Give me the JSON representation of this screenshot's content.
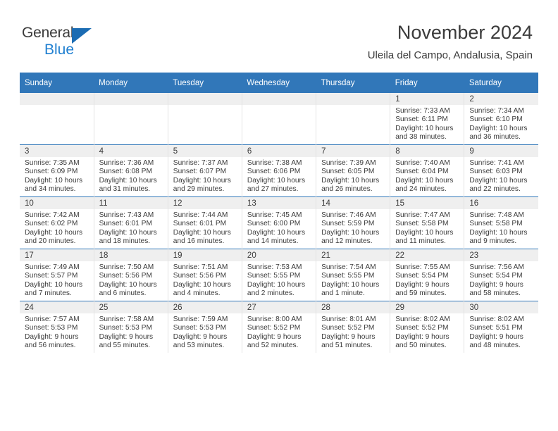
{
  "brand": {
    "name_part1": "General",
    "name_part2": "Blue",
    "triangle_color": "#1b6cb3",
    "blue_color": "#1f7fd0"
  },
  "header": {
    "title": "November 2024",
    "location": "Uleila del Campo, Andalusia, Spain"
  },
  "theme": {
    "header_blue": "#3177b9",
    "row_line_blue": "#3177b9",
    "daynum_band": "#efefef",
    "text": "#3b3b3b"
  },
  "weekday_headers": [
    "Sunday",
    "Monday",
    "Tuesday",
    "Wednesday",
    "Thursday",
    "Friday",
    "Saturday"
  ],
  "weeks": [
    [
      {
        "day": "",
        "sunrise": "",
        "sunset": "",
        "daylight_line1": "",
        "daylight_line2": ""
      },
      {
        "day": "",
        "sunrise": "",
        "sunset": "",
        "daylight_line1": "",
        "daylight_line2": ""
      },
      {
        "day": "",
        "sunrise": "",
        "sunset": "",
        "daylight_line1": "",
        "daylight_line2": ""
      },
      {
        "day": "",
        "sunrise": "",
        "sunset": "",
        "daylight_line1": "",
        "daylight_line2": ""
      },
      {
        "day": "",
        "sunrise": "",
        "sunset": "",
        "daylight_line1": "",
        "daylight_line2": ""
      },
      {
        "day": "1",
        "sunrise": "Sunrise: 7:33 AM",
        "sunset": "Sunset: 6:11 PM",
        "daylight_line1": "Daylight: 10 hours",
        "daylight_line2": "and 38 minutes."
      },
      {
        "day": "2",
        "sunrise": "Sunrise: 7:34 AM",
        "sunset": "Sunset: 6:10 PM",
        "daylight_line1": "Daylight: 10 hours",
        "daylight_line2": "and 36 minutes."
      }
    ],
    [
      {
        "day": "3",
        "sunrise": "Sunrise: 7:35 AM",
        "sunset": "Sunset: 6:09 PM",
        "daylight_line1": "Daylight: 10 hours",
        "daylight_line2": "and 34 minutes."
      },
      {
        "day": "4",
        "sunrise": "Sunrise: 7:36 AM",
        "sunset": "Sunset: 6:08 PM",
        "daylight_line1": "Daylight: 10 hours",
        "daylight_line2": "and 31 minutes."
      },
      {
        "day": "5",
        "sunrise": "Sunrise: 7:37 AM",
        "sunset": "Sunset: 6:07 PM",
        "daylight_line1": "Daylight: 10 hours",
        "daylight_line2": "and 29 minutes."
      },
      {
        "day": "6",
        "sunrise": "Sunrise: 7:38 AM",
        "sunset": "Sunset: 6:06 PM",
        "daylight_line1": "Daylight: 10 hours",
        "daylight_line2": "and 27 minutes."
      },
      {
        "day": "7",
        "sunrise": "Sunrise: 7:39 AM",
        "sunset": "Sunset: 6:05 PM",
        "daylight_line1": "Daylight: 10 hours",
        "daylight_line2": "and 26 minutes."
      },
      {
        "day": "8",
        "sunrise": "Sunrise: 7:40 AM",
        "sunset": "Sunset: 6:04 PM",
        "daylight_line1": "Daylight: 10 hours",
        "daylight_line2": "and 24 minutes."
      },
      {
        "day": "9",
        "sunrise": "Sunrise: 7:41 AM",
        "sunset": "Sunset: 6:03 PM",
        "daylight_line1": "Daylight: 10 hours",
        "daylight_line2": "and 22 minutes."
      }
    ],
    [
      {
        "day": "10",
        "sunrise": "Sunrise: 7:42 AM",
        "sunset": "Sunset: 6:02 PM",
        "daylight_line1": "Daylight: 10 hours",
        "daylight_line2": "and 20 minutes."
      },
      {
        "day": "11",
        "sunrise": "Sunrise: 7:43 AM",
        "sunset": "Sunset: 6:01 PM",
        "daylight_line1": "Daylight: 10 hours",
        "daylight_line2": "and 18 minutes."
      },
      {
        "day": "12",
        "sunrise": "Sunrise: 7:44 AM",
        "sunset": "Sunset: 6:01 PM",
        "daylight_line1": "Daylight: 10 hours",
        "daylight_line2": "and 16 minutes."
      },
      {
        "day": "13",
        "sunrise": "Sunrise: 7:45 AM",
        "sunset": "Sunset: 6:00 PM",
        "daylight_line1": "Daylight: 10 hours",
        "daylight_line2": "and 14 minutes."
      },
      {
        "day": "14",
        "sunrise": "Sunrise: 7:46 AM",
        "sunset": "Sunset: 5:59 PM",
        "daylight_line1": "Daylight: 10 hours",
        "daylight_line2": "and 12 minutes."
      },
      {
        "day": "15",
        "sunrise": "Sunrise: 7:47 AM",
        "sunset": "Sunset: 5:58 PM",
        "daylight_line1": "Daylight: 10 hours",
        "daylight_line2": "and 11 minutes."
      },
      {
        "day": "16",
        "sunrise": "Sunrise: 7:48 AM",
        "sunset": "Sunset: 5:58 PM",
        "daylight_line1": "Daylight: 10 hours",
        "daylight_line2": "and 9 minutes."
      }
    ],
    [
      {
        "day": "17",
        "sunrise": "Sunrise: 7:49 AM",
        "sunset": "Sunset: 5:57 PM",
        "daylight_line1": "Daylight: 10 hours",
        "daylight_line2": "and 7 minutes."
      },
      {
        "day": "18",
        "sunrise": "Sunrise: 7:50 AM",
        "sunset": "Sunset: 5:56 PM",
        "daylight_line1": "Daylight: 10 hours",
        "daylight_line2": "and 6 minutes."
      },
      {
        "day": "19",
        "sunrise": "Sunrise: 7:51 AM",
        "sunset": "Sunset: 5:56 PM",
        "daylight_line1": "Daylight: 10 hours",
        "daylight_line2": "and 4 minutes."
      },
      {
        "day": "20",
        "sunrise": "Sunrise: 7:53 AM",
        "sunset": "Sunset: 5:55 PM",
        "daylight_line1": "Daylight: 10 hours",
        "daylight_line2": "and 2 minutes."
      },
      {
        "day": "21",
        "sunrise": "Sunrise: 7:54 AM",
        "sunset": "Sunset: 5:55 PM",
        "daylight_line1": "Daylight: 10 hours",
        "daylight_line2": "and 1 minute."
      },
      {
        "day": "22",
        "sunrise": "Sunrise: 7:55 AM",
        "sunset": "Sunset: 5:54 PM",
        "daylight_line1": "Daylight: 9 hours",
        "daylight_line2": "and 59 minutes."
      },
      {
        "day": "23",
        "sunrise": "Sunrise: 7:56 AM",
        "sunset": "Sunset: 5:54 PM",
        "daylight_line1": "Daylight: 9 hours",
        "daylight_line2": "and 58 minutes."
      }
    ],
    [
      {
        "day": "24",
        "sunrise": "Sunrise: 7:57 AM",
        "sunset": "Sunset: 5:53 PM",
        "daylight_line1": "Daylight: 9 hours",
        "daylight_line2": "and 56 minutes."
      },
      {
        "day": "25",
        "sunrise": "Sunrise: 7:58 AM",
        "sunset": "Sunset: 5:53 PM",
        "daylight_line1": "Daylight: 9 hours",
        "daylight_line2": "and 55 minutes."
      },
      {
        "day": "26",
        "sunrise": "Sunrise: 7:59 AM",
        "sunset": "Sunset: 5:53 PM",
        "daylight_line1": "Daylight: 9 hours",
        "daylight_line2": "and 53 minutes."
      },
      {
        "day": "27",
        "sunrise": "Sunrise: 8:00 AM",
        "sunset": "Sunset: 5:52 PM",
        "daylight_line1": "Daylight: 9 hours",
        "daylight_line2": "and 52 minutes."
      },
      {
        "day": "28",
        "sunrise": "Sunrise: 8:01 AM",
        "sunset": "Sunset: 5:52 PM",
        "daylight_line1": "Daylight: 9 hours",
        "daylight_line2": "and 51 minutes."
      },
      {
        "day": "29",
        "sunrise": "Sunrise: 8:02 AM",
        "sunset": "Sunset: 5:52 PM",
        "daylight_line1": "Daylight: 9 hours",
        "daylight_line2": "and 50 minutes."
      },
      {
        "day": "30",
        "sunrise": "Sunrise: 8:02 AM",
        "sunset": "Sunset: 5:51 PM",
        "daylight_line1": "Daylight: 9 hours",
        "daylight_line2": "and 48 minutes."
      }
    ]
  ]
}
